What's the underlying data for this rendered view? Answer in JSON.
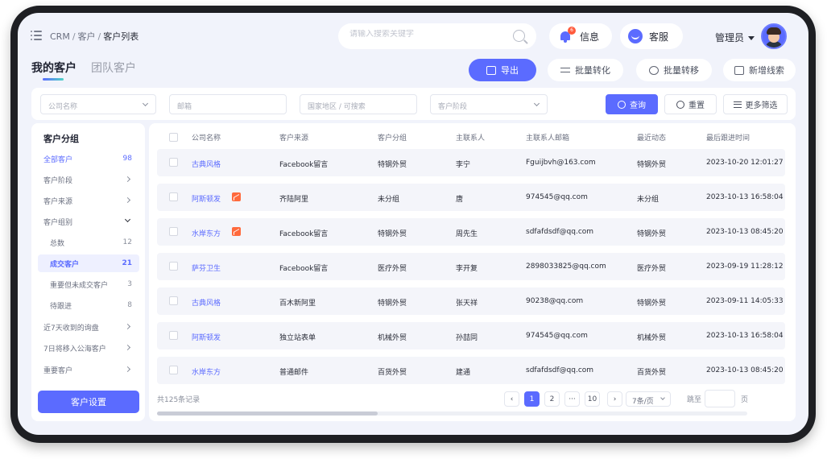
{
  "breadcrumb": {
    "items": [
      "CRM",
      "客户"
    ],
    "current": "客户列表"
  },
  "search": {
    "placeholder": "请输入搜索关键字"
  },
  "header": {
    "notify_label": "信息",
    "notify_badge": "6",
    "service_label": "客服",
    "admin_label": "管理员"
  },
  "tabs": [
    {
      "label": "我的客户",
      "active": true
    },
    {
      "label": "团队客户",
      "active": false
    }
  ],
  "actions": {
    "export": "导出",
    "batch_convert": "批量转化",
    "batch_transfer": "批量转移",
    "add_lead": "新增线索"
  },
  "filters": {
    "company_placeholder": "公司名称",
    "email_placeholder": "邮箱",
    "region_placeholder": "国家地区 / 可搜索",
    "stage_placeholder": "客户阶段",
    "query": "查询",
    "reset": "重置",
    "more": "更多筛选"
  },
  "sidebar": {
    "title": "客户分组",
    "items": [
      {
        "label": "全部客户",
        "count": "98",
        "style": "blue"
      },
      {
        "label": "客户阶段",
        "arrow": "right"
      },
      {
        "label": "客户来源",
        "arrow": "right"
      },
      {
        "label": "客户组别",
        "arrow": "down"
      },
      {
        "label": "总数",
        "count": "12",
        "sub": true
      },
      {
        "label": "成交客户",
        "count": "21",
        "sub": true,
        "active": true
      },
      {
        "label": "重要但未成交客户",
        "count": "3",
        "sub": true
      },
      {
        "label": "待跟进",
        "count": "8",
        "sub": true
      },
      {
        "label": "近7天收到的询盘",
        "arrow": "right"
      },
      {
        "label": "7日将移入公海客户",
        "arrow": "right"
      },
      {
        "label": "重要客户",
        "arrow": "right"
      }
    ],
    "settings_button": "客户设置"
  },
  "table": {
    "columns": [
      "公司名称",
      "客户来源",
      "客户分组",
      "主联系人",
      "主联系人邮箱",
      "最近动态",
      "最后跟进时间"
    ],
    "rows": [
      {
        "company": "古典风格",
        "source": "Facebook留言",
        "group": "特钢外贸",
        "contact": "李宁",
        "email": "Fguijbvh@163.com",
        "activity": "特钢外贸",
        "time": "2023-10-20 12:01:27",
        "trend": false
      },
      {
        "company": "阿斯顿发",
        "source": "齐陆阿里",
        "group": "未分组",
        "contact": "唐",
        "email": "974545@qq.com",
        "activity": "未分组",
        "time": "2023-10-13 16:58:04",
        "trend": true
      },
      {
        "company": "水岸东方",
        "source": "Facebook留言",
        "group": "特钢外贸",
        "contact": "周先生",
        "email": "sdfafdsdf@qq.com",
        "activity": "特钢外贸",
        "time": "2023-10-13 08:45:20",
        "trend": true
      },
      {
        "company": "萨芬卫生",
        "source": "Facebook留言",
        "group": "医疗外贸",
        "contact": "李开复",
        "email": "2898033825@qq.com",
        "activity": "医疗外贸",
        "time": "2023-09-19 11:28:12",
        "trend": false
      },
      {
        "company": "古典风格",
        "source": "百木新阿里",
        "group": "特钢外贸",
        "contact": "张天祥",
        "email": "90238@qq.com",
        "activity": "特钢外贸",
        "time": "2023-09-11 14:05:33",
        "trend": false
      },
      {
        "company": "阿斯顿发",
        "source": "独立站表单",
        "group": "机械外贸",
        "contact": "孙喆同",
        "email": "974545@qq.com",
        "activity": "机械外贸",
        "time": "2023-10-13 16:58:04",
        "trend": false
      },
      {
        "company": "水岸东方",
        "source": "普通邮件",
        "group": "百货外贸",
        "contact": "建通",
        "email": "sdfafdsdf@qq.com",
        "activity": "百货外贸",
        "time": "2023-10-13 08:45:20",
        "trend": false
      }
    ]
  },
  "pagination": {
    "total_text": "共125条记录",
    "pages": [
      "1",
      "2",
      "···",
      "10"
    ],
    "current": "1",
    "page_size": "7条/页",
    "jump_label": "跳至",
    "page_unit": "页"
  },
  "colors": {
    "accent": "#5b6bff",
    "trend": "#ff6a3d",
    "badge": "#ff5a3c"
  }
}
